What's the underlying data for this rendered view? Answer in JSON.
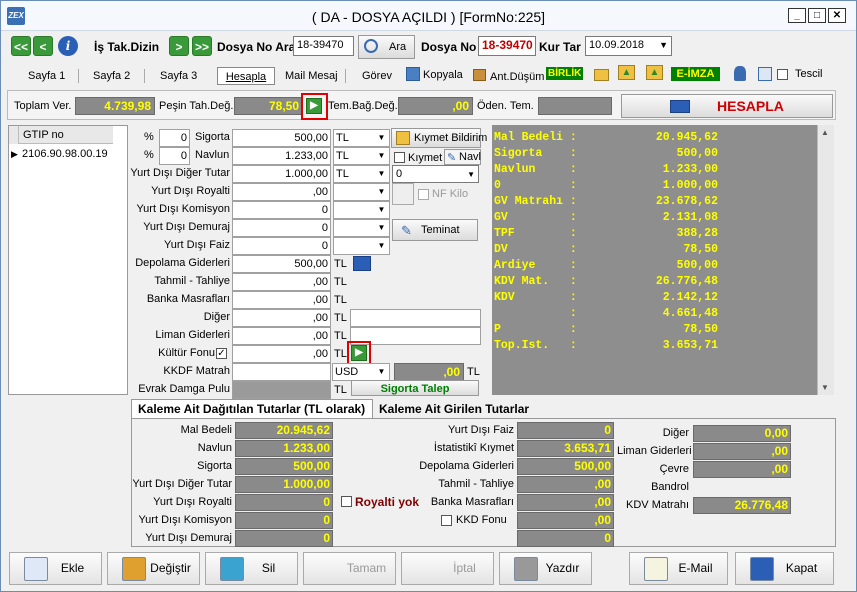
{
  "title": "( DA  - DOSYA AÇILDI ) [FormNo:225]",
  "app_icon": "ZEX",
  "window_buttons": {
    "min": "_",
    "max": "□",
    "close": "✕"
  },
  "toolbar": {
    "is_tak_label": "İş Tak.Dizin",
    "dosya_no_ara_label": "Dosya No Ara",
    "dosya_no_ara_value": "18-39470",
    "ara_button": "Ara",
    "dosya_no_label": "Dosya No",
    "dosya_no_value": "18-39470",
    "kur_tar_label": "Kur Tar",
    "kur_tar_value": "10.09.2018",
    "nav_left": "<",
    "nav_left2": "<<",
    "nav_right": ">",
    "nav_right2": ">>",
    "info": "i"
  },
  "tabs": [
    "Sayfa 1",
    "Sayfa 2",
    "Sayfa 3",
    "Hesapla",
    "Mail Mesaj",
    "Görev"
  ],
  "tools": {
    "kopyala": "Kopyala",
    "ant_dusum": "Ant.Düşüm",
    "birlik": "BİRLİK",
    "e_imza": "E-İMZA",
    "tescil": "Tescil"
  },
  "totals": {
    "toplam_ver_label": "Toplam Ver.",
    "toplam_ver_value": "4.739,98",
    "pesin_label": "Peşin Tah.Değ.",
    "pesin_value": "78,50",
    "tem_bag_label": "Tem.Bağ.Değ.",
    "tem_bag_value": ",00",
    "oden_label": "Öden. Tem.",
    "oden_value": "",
    "hesapla": "HESAPLA"
  },
  "gtip": {
    "header": "GTIP no",
    "row": "2106.90.98.00.19"
  },
  "form": {
    "pct_sym": "%",
    "sig_pct": "0",
    "nav_pct": "0",
    "tl": "TL",
    "usd": "USD",
    "rows": [
      {
        "label": "Sigorta",
        "value": "500,00"
      },
      {
        "label": "Navlun",
        "value": "1.233,00"
      },
      {
        "label": "Yurt Dışı Diğer Tutar",
        "value": "1.000,00"
      },
      {
        "label": "Yurt Dışı Royalti",
        "value": ",00"
      },
      {
        "label": "Yurt Dışı Komisyon",
        "value": "0"
      },
      {
        "label": "Yurt Dışı Demuraj",
        "value": "0"
      },
      {
        "label": "Yurt Dışı Faiz",
        "value": "0"
      },
      {
        "label": "Depolama Giderleri",
        "value": "500,00"
      },
      {
        "label": "Tahmil - Tahliye",
        "value": ",00"
      },
      {
        "label": "Banka Masrafları",
        "value": ",00"
      },
      {
        "label": "Diğer",
        "value": ",00"
      },
      {
        "label": "Liman Giderleri",
        "value": ",00"
      },
      {
        "label": "Kültür Fonu",
        "value": ",00"
      },
      {
        "label": "KKDF Matrah",
        "value": ""
      },
      {
        "label": "Evrak Damga Pulu",
        "value": ""
      }
    ],
    "kkdf_tl_value": ",00",
    "kiymet_bildirim": "Kıymet Bildirim",
    "kiymet": "Kıymet",
    "navl": "Navl",
    "combo0": "0",
    "nf_kilo": "NF Kilo",
    "teminat": "Teminat",
    "sigorta_talep": "Sigorta Talep"
  },
  "summary": [
    {
      "k": "Mal Bedeli :",
      "v": "20.945,62"
    },
    {
      "k": "Sigorta    :",
      "v": "500,00"
    },
    {
      "k": "Navlun     :",
      "v": "1.233,00"
    },
    {
      "k": "0          :",
      "v": "1.000,00"
    },
    {
      "k": "GV Matrahı :",
      "v": "23.678,62"
    },
    {
      "k": "GV         :",
      "v": "2.131,08"
    },
    {
      "k": "TPF        :",
      "v": "388,28"
    },
    {
      "k": "DV         :",
      "v": "78,50"
    },
    {
      "k": "Ardiye     :",
      "v": "500,00"
    },
    {
      "k": "KDV Mat.   :",
      "v": "26.776,48"
    },
    {
      "k": "KDV        :",
      "v": "2.142,12"
    },
    {
      "k": "           :",
      "v": "4.661,48"
    },
    {
      "k": "P          :",
      "v": "78,50"
    },
    {
      "k": "Top.Ist.   :",
      "v": "3.653,71"
    }
  ],
  "bottom_tabs": [
    "Kaleme Ait Dağıtılan Tutarlar (TL olarak)",
    "Kaleme Ait Girilen Tutarlar"
  ],
  "bottom": {
    "col1": [
      {
        "label": "Mal Bedeli",
        "value": "20.945,62"
      },
      {
        "label": "Navlun",
        "value": "1.233,00"
      },
      {
        "label": "Sigorta",
        "value": "500,00"
      },
      {
        "label": "Yurt Dışı Diğer Tutar",
        "value": "1.000,00"
      },
      {
        "label": "Yurt Dışı Royalti",
        "value": "0"
      },
      {
        "label": "Yurt Dışı Komisyon",
        "value": "0"
      },
      {
        "label": "Yurt Dışı Demuraj",
        "value": "0"
      }
    ],
    "col2": [
      {
        "label": "Yurt Dışı Faiz",
        "value": "0"
      },
      {
        "label": "İstatistikî Kıymet",
        "value": "3.653,71"
      },
      {
        "label": "Depolama Giderleri",
        "value": "500,00"
      },
      {
        "label": "Tahmil - Tahliye",
        "value": ",00"
      },
      {
        "label": "Banka Masrafları",
        "value": ",00"
      },
      {
        "label": "KKD Fonu",
        "value": ",00"
      },
      {
        "label": "",
        "value": "0"
      }
    ],
    "col3": [
      {
        "label": "Diğer",
        "value": "0,00"
      },
      {
        "label": "Liman Giderleri",
        "value": ",00"
      },
      {
        "label": "Çevre",
        "value": ",00"
      },
      {
        "label": "Bandrol",
        "value": ""
      },
      {
        "label": "KDV Matrahı",
        "value": "26.776,48"
      }
    ],
    "royalti_yok": "Royalti yok"
  },
  "footer": [
    "Ekle",
    "Değiştir",
    "Sil",
    "Tamam",
    "İptal",
    "Yazdır",
    "E-Mail",
    "Kapat"
  ]
}
